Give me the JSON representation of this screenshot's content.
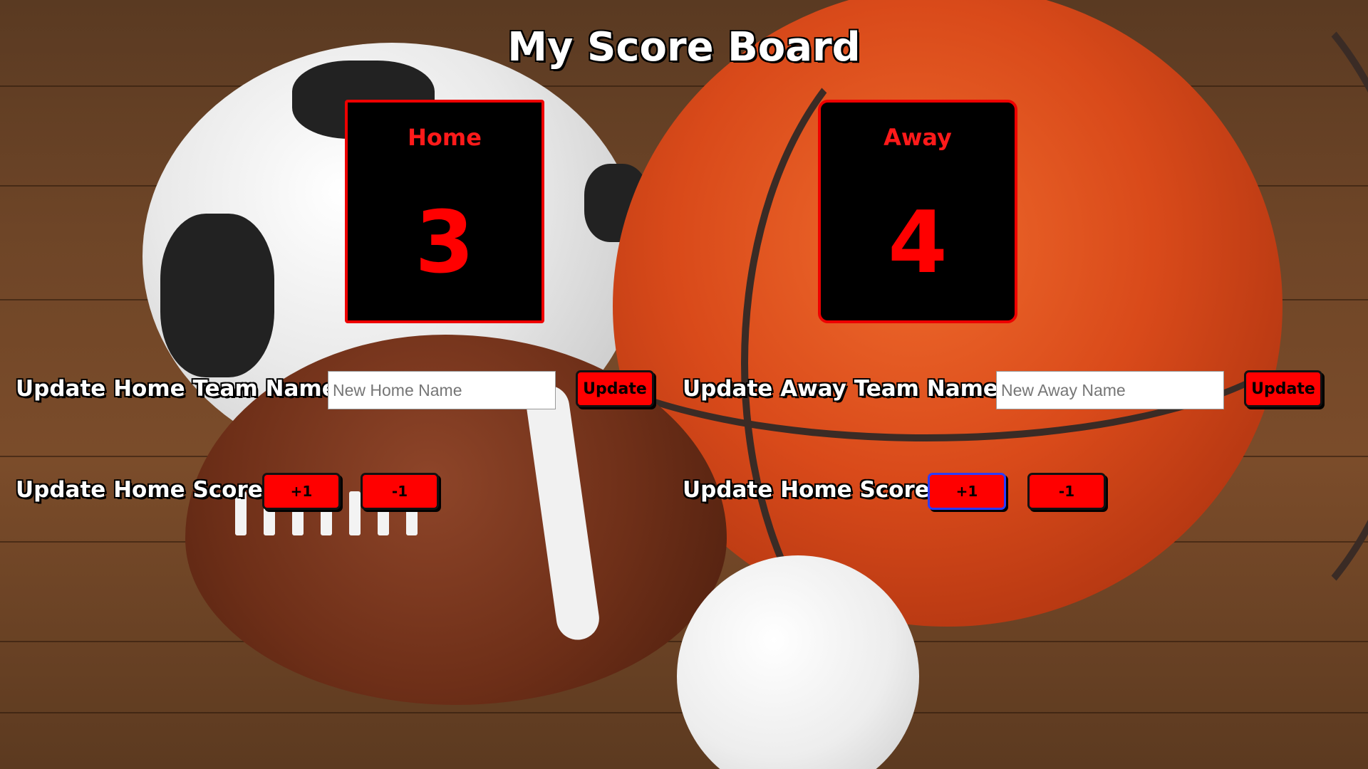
{
  "title": "My Score Board",
  "home": {
    "team_name": "Home",
    "score": "3",
    "name_label": "Update Home Team Name",
    "name_placeholder": "New Home Name",
    "update_label": "Update",
    "score_label": "Update Home Score",
    "plus_label": "+1",
    "minus_label": "-1"
  },
  "away": {
    "team_name": "Away",
    "score": "4",
    "name_label": "Update Away Team Name",
    "name_placeholder": "New Away Name",
    "update_label": "Update",
    "score_label": "Update Home Score",
    "plus_label": "+1",
    "minus_label": "-1"
  },
  "colors": {
    "accent": "#ff0000",
    "card_bg": "#000000",
    "label_text": "#ffffff"
  }
}
